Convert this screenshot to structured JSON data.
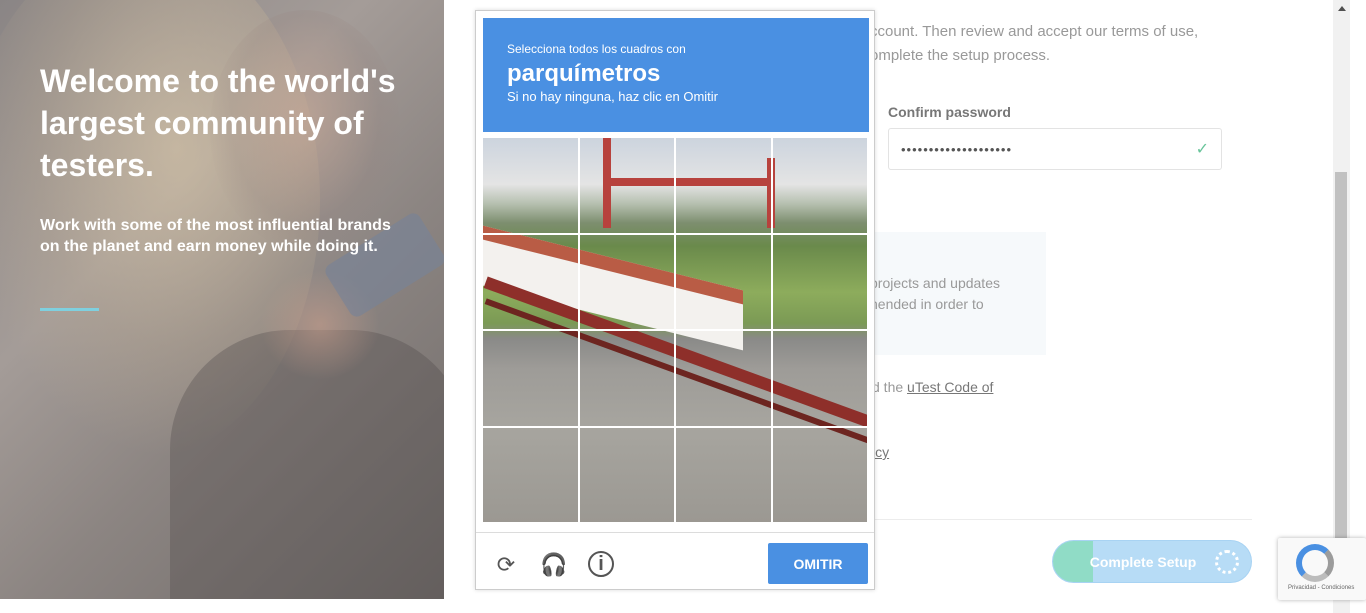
{
  "hero": {
    "title": "Welcome to the world's largest community of testers.",
    "subtitle": "Work with some of the most influential brands on the planet and earn money while doing it."
  },
  "form": {
    "intro": "ccount. Then review and accept our terms of use, omplete the setup process.",
    "confirm_password_label": "Confirm password",
    "confirm_password_value": "••••••••••••••••••••",
    "info_text": "projects and updates hended in order to",
    "coc_prefix": "d the ",
    "coc_link": "uTest Code of",
    "policy_link": "icy",
    "complete_button": "Complete Setup"
  },
  "captcha": {
    "instruction": "Selecciona todos los cuadros con",
    "target": "parquímetros",
    "hint": "Si no hay ninguna, haz clic en Omitir",
    "skip_button": "OMITIR",
    "icons": [
      "reload-icon",
      "audio-icon",
      "info-icon"
    ]
  },
  "recaptcha_badge": {
    "footer": "Privacidad - Condiciones"
  },
  "colors": {
    "captcha_blue": "#4a90e2",
    "accent_line": "#7fd0df",
    "button_fill": "#90dcc6",
    "button_bg": "#b7dcf6"
  }
}
